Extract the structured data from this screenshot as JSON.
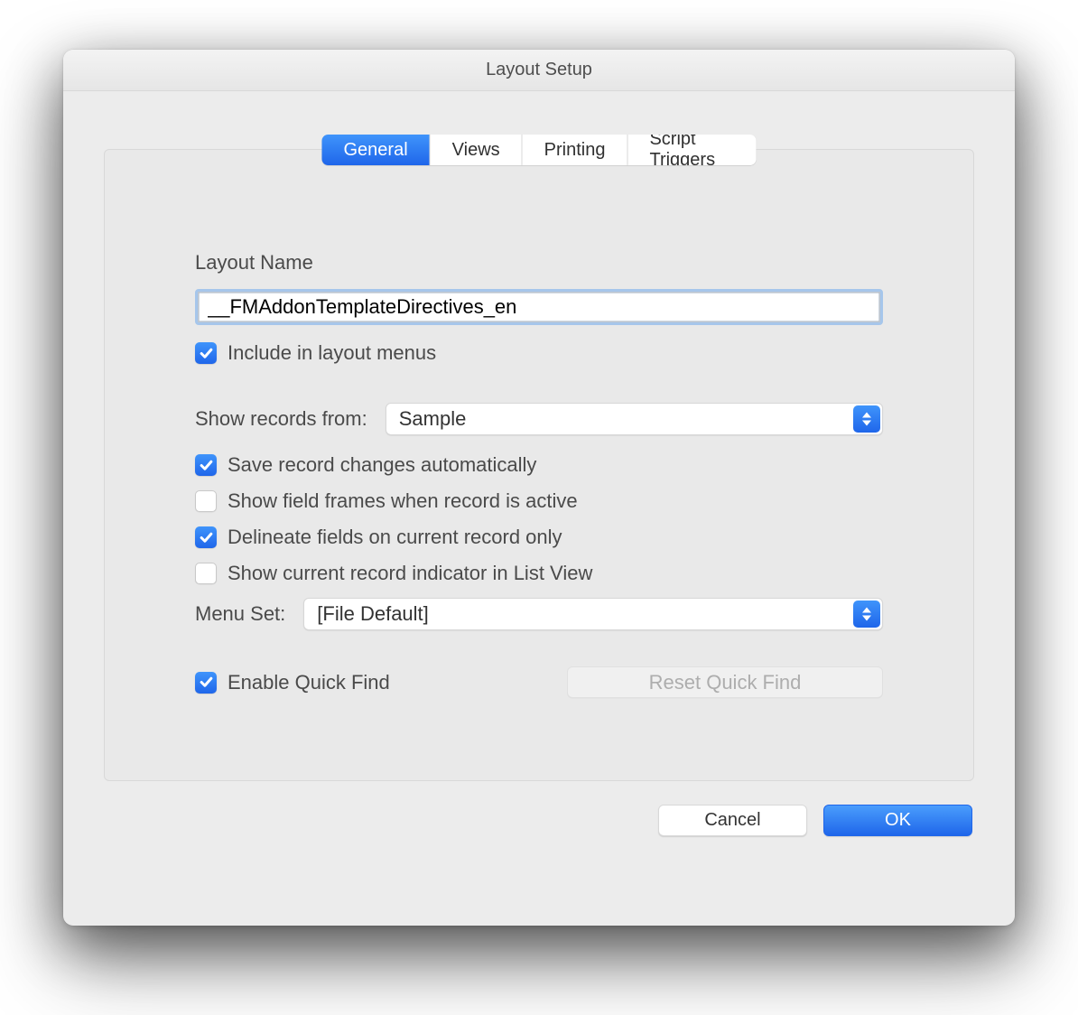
{
  "window": {
    "title": "Layout Setup"
  },
  "tabs": [
    "General",
    "Views",
    "Printing",
    "Script Triggers"
  ],
  "active_tab": 0,
  "layout_name": {
    "label": "Layout Name",
    "value": "__FMAddonTemplateDirectives_en"
  },
  "include_in_menus": {
    "label": "Include in layout menus",
    "checked": true
  },
  "show_records": {
    "label": "Show records from:",
    "value": "Sample"
  },
  "save_auto": {
    "label": "Save record changes automatically",
    "checked": true
  },
  "show_frames": {
    "label": "Show field frames when record is active",
    "checked": false
  },
  "delineate": {
    "label": "Delineate fields on current record only",
    "checked": true
  },
  "list_indicator": {
    "label": "Show current record indicator in List View",
    "checked": false
  },
  "menu_set": {
    "label": "Menu Set:",
    "value": "[File Default]"
  },
  "quick_find": {
    "label": "Enable Quick Find",
    "checked": true
  },
  "reset_qf": {
    "label": "Reset Quick Find"
  },
  "buttons": {
    "cancel": "Cancel",
    "ok": "OK"
  }
}
